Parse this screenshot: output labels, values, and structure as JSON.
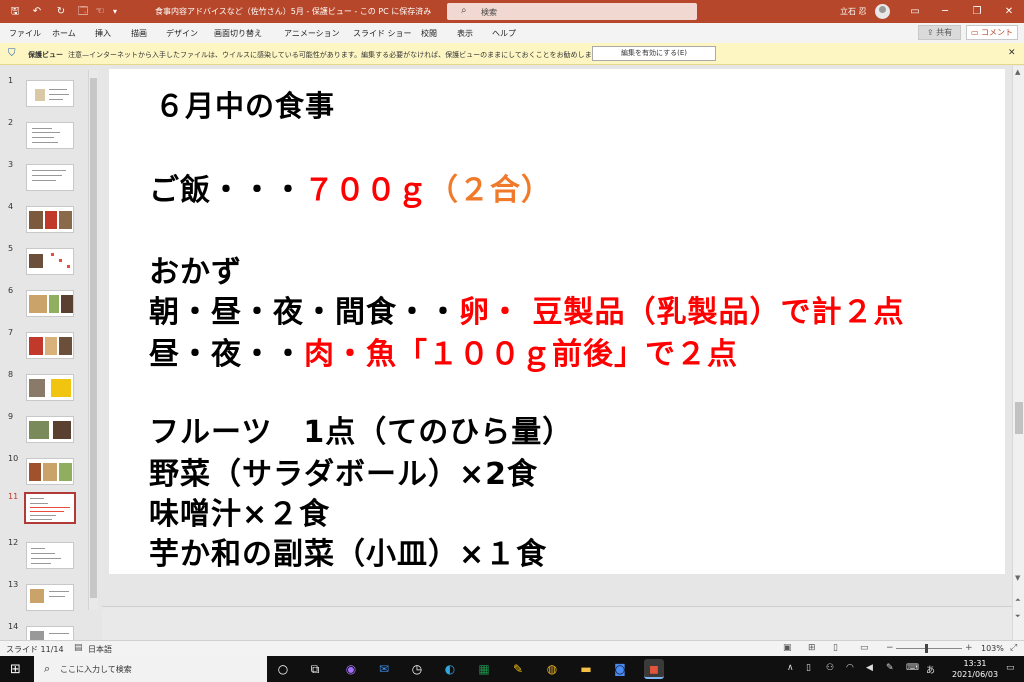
{
  "titlebar": {
    "doc_title": "食事内容アドバイスなど（佐竹さん）5月 - 保護ビュー - この PC に保存済み",
    "autosave": "オン",
    "search_placeholder": "検索",
    "user_name": "立石 忍",
    "accent": "#b7472a"
  },
  "ribbon": {
    "tabs": [
      "ファイル",
      "ホーム",
      "挿入",
      "描画",
      "デザイン",
      "画面切り替え",
      "アニメーション",
      "スライド ショー",
      "校閲",
      "表示",
      "ヘルプ"
    ],
    "share_label": "共有",
    "comment_label": "コメント"
  },
  "protected_view": {
    "label": "保護ビュー",
    "message": "注意—インターネットから入手したファイルは、ウイルスに感染している可能性があります。編集する必要がなければ、保護ビューのままにしておくことをお勧めします。",
    "enable_button": "編集を有効にする(E)",
    "bg_color": "#fdf6c3"
  },
  "thumbnails": {
    "numbers": [
      "1",
      "2",
      "3",
      "4",
      "5",
      "6",
      "7",
      "8",
      "9",
      "10",
      "11",
      "12",
      "13",
      "14"
    ],
    "active": "11"
  },
  "slide": {
    "line1": "６月中の食事",
    "line2a": "ご飯・・・",
    "line2b": "７００ｇ",
    "line2c": "（２合）",
    "line3": "おかず",
    "line4a": "朝・昼・夜・間食・・",
    "line4b": "卵・ 豆製品（乳製品）で計２点",
    "line5a": "昼・夜・・",
    "line5b": "肉・魚「１００ｇ前後」で２点",
    "line6": "フルーツ　1点（てのひら量）",
    "line7": "野菜（サラダボール）×2食",
    "line8": "味噌汁×２食",
    "line9": "芋か和の副菜（小皿）×１食",
    "highlight_red": "#ff0000",
    "highlight_orange": "#f07a2a"
  },
  "statusbar": {
    "slide_info": "スライド 11/14",
    "language": "日本語",
    "zoom": "103%"
  },
  "taskbar": {
    "search_placeholder": "ここに入力して検索",
    "time": "13:31",
    "date": "2021/06/03",
    "ime": "あ"
  }
}
